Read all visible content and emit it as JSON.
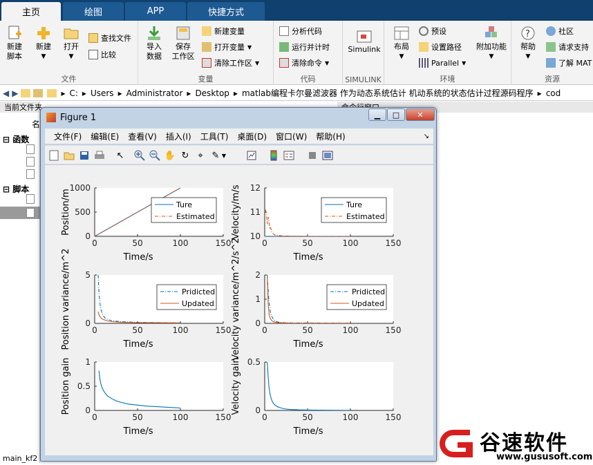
{
  "tabs": [
    "主页",
    "绘图",
    "APP",
    "快捷方式"
  ],
  "ribbon": {
    "file": {
      "label": "文件",
      "new_script": "新建\n脚本",
      "new": "新建",
      "open": "打开",
      "find_files": "查找文件",
      "compare": "比较"
    },
    "variable": {
      "label": "变量",
      "import": "导入\n数据",
      "save_ws": "保存\n工作区",
      "new_var": "新建变量",
      "open_var": "打开变量",
      "clear_ws": "清除工作区"
    },
    "code": {
      "label": "代码",
      "analyze": "分析代码",
      "run_time": "运行并计时",
      "clear_cmd": "清除命令"
    },
    "simulink": {
      "label": "SIMULINK",
      "btn": "Simulink"
    },
    "env": {
      "label": "环境",
      "layout": "布局",
      "prefs": "预设",
      "set_path": "设置路径",
      "parallel": "Parallel",
      "addons": "附加功能"
    },
    "resources": {
      "label": "资源",
      "help": "帮助",
      "community": "社区",
      "request": "请求支持",
      "learn": "了解 MAT"
    }
  },
  "address": {
    "parts": [
      "C:",
      "Users",
      "Administrator",
      "Desktop",
      "matlab编程卡尔曼滤波器 作为动态系统估计 机动系统的状态估计过程源码程序",
      "cod"
    ]
  },
  "leftpanel": {
    "header": "当前文件夹",
    "col": "名",
    "func": "函数",
    "script": "脚本",
    "bottom": "main_kf2"
  },
  "cmdheader": "命令行窗口",
  "figure": {
    "title": "Figure 1",
    "menu": [
      "文件(F)",
      "编辑(E)",
      "查看(V)",
      "插入(I)",
      "工具(T)",
      "桌面(D)",
      "窗口(W)",
      "帮助(H)"
    ]
  },
  "watermark": {
    "brand": "谷速软件",
    "url": "www.gususoft.com"
  },
  "chart_data": [
    {
      "type": "line",
      "ylabel": "Position/m",
      "xlabel": "Time/s",
      "xlim": [
        0,
        150
      ],
      "ylim": [
        0,
        1000
      ],
      "xticks": [
        0,
        50,
        100,
        150
      ],
      "yticks": [
        0,
        500,
        1000
      ],
      "legend": "top-right",
      "series": [
        {
          "name": "Ture",
          "color": "#0072bd",
          "dash": "",
          "x": [
            0,
            100
          ],
          "y": [
            0,
            1000
          ]
        },
        {
          "name": "Estimated",
          "color": "#d95319",
          "dash": "5,2,1,2",
          "x": [
            0,
            100
          ],
          "y": [
            0,
            1000
          ]
        }
      ]
    },
    {
      "type": "line",
      "ylabel": "Velocity/m/s",
      "xlabel": "Time/s",
      "xlim": [
        0,
        150
      ],
      "ylim": [
        10,
        12
      ],
      "xticks": [
        0,
        50,
        100,
        150
      ],
      "yticks": [
        10,
        11,
        12
      ],
      "legend": "top-right",
      "series": [
        {
          "name": "Ture",
          "color": "#0072bd",
          "dash": "",
          "x": [
            0,
            100
          ],
          "y": [
            10,
            10
          ]
        },
        {
          "name": "Estimated",
          "color": "#d95319",
          "dash": "5,2,1,2",
          "x": [
            1,
            2,
            3,
            4,
            5,
            6,
            7,
            8,
            9,
            10,
            12,
            15,
            20,
            30,
            50,
            100
          ],
          "y": [
            11.1,
            10.9,
            10.5,
            10.8,
            10.6,
            10.3,
            10.35,
            10.2,
            10.15,
            10.1,
            10.05,
            10.04,
            10.02,
            10.01,
            10.0,
            10.0
          ]
        }
      ]
    },
    {
      "type": "line",
      "ylabel": "Position variance/m^2",
      "xlabel": "Time/s",
      "xlim": [
        0,
        150
      ],
      "ylim": [
        0,
        5
      ],
      "xticks": [
        0,
        50,
        100,
        150
      ],
      "yticks": [
        0,
        5
      ],
      "legend": "top-right",
      "series": [
        {
          "name": "Pridicted",
          "color": "#0072bd",
          "dash": "5,2,1,2",
          "x": [
            4,
            5,
            6,
            7,
            8,
            10,
            12,
            15,
            20,
            30,
            50,
            100
          ],
          "y": [
            5,
            3.2,
            2.2,
            1.6,
            1.2,
            0.8,
            0.55,
            0.4,
            0.28,
            0.18,
            0.1,
            0.05
          ]
        },
        {
          "name": "Updated",
          "color": "#d95319",
          "dash": "",
          "x": [
            4,
            5,
            6,
            8,
            10,
            15,
            20,
            30,
            50,
            100
          ],
          "y": [
            1.2,
            0.9,
            0.7,
            0.5,
            0.4,
            0.25,
            0.18,
            0.12,
            0.07,
            0.04
          ]
        }
      ]
    },
    {
      "type": "line",
      "ylabel": "Velocity variance/m^2/s^2",
      "xlabel": "Time/s",
      "xlim": [
        0,
        150
      ],
      "ylim": [
        0,
        2
      ],
      "xticks": [
        0,
        50,
        100,
        150
      ],
      "yticks": [
        0,
        1,
        2
      ],
      "legend": "top-right",
      "series": [
        {
          "name": "Pridicted",
          "color": "#0072bd",
          "dash": "5,2,1,2",
          "x": [
            3,
            4,
            5,
            6,
            7,
            8,
            10,
            12,
            15,
            20,
            30,
            100
          ],
          "y": [
            2,
            1.4,
            0.9,
            0.6,
            0.4,
            0.3,
            0.18,
            0.1,
            0.06,
            0.03,
            0.02,
            0.01
          ]
        },
        {
          "name": "Updated",
          "color": "#d95319",
          "dash": "",
          "x": [
            3,
            4,
            5,
            6,
            8,
            10,
            15,
            20,
            30,
            100
          ],
          "y": [
            1.9,
            0.8,
            0.4,
            0.25,
            0.12,
            0.07,
            0.03,
            0.02,
            0.01,
            0.005
          ]
        }
      ]
    },
    {
      "type": "line",
      "ylabel": "Position gain",
      "xlabel": "Time/s",
      "xlim": [
        0,
        150
      ],
      "ylim": [
        0,
        1
      ],
      "xticks": [
        0,
        50,
        100,
        150
      ],
      "yticks": [
        0,
        0.5,
        1
      ],
      "series": [
        {
          "name": "",
          "color": "#0072bd",
          "dash": "",
          "x": [
            5,
            6,
            7,
            8,
            10,
            12,
            15,
            20,
            25,
            30,
            40,
            50,
            60,
            80,
            100
          ],
          "y": [
            0.82,
            0.66,
            0.56,
            0.5,
            0.42,
            0.36,
            0.3,
            0.24,
            0.2,
            0.17,
            0.13,
            0.11,
            0.09,
            0.07,
            0.05
          ]
        }
      ]
    },
    {
      "type": "line",
      "ylabel": "Velocity gain",
      "xlabel": "Time/s",
      "xlim": [
        0,
        150
      ],
      "ylim": [
        0,
        0.5
      ],
      "xticks": [
        0,
        50,
        100,
        150
      ],
      "yticks": [
        0,
        0.5
      ],
      "series": [
        {
          "name": "",
          "color": "#0072bd",
          "dash": "",
          "x": [
            3,
            4,
            5,
            6,
            7,
            8,
            10,
            12,
            15,
            20,
            25,
            30,
            40,
            50,
            70,
            100
          ],
          "y": [
            0.5,
            0.35,
            0.24,
            0.18,
            0.14,
            0.11,
            0.075,
            0.055,
            0.038,
            0.022,
            0.014,
            0.01,
            0.006,
            0.004,
            0.002,
            0.001
          ]
        }
      ]
    }
  ]
}
